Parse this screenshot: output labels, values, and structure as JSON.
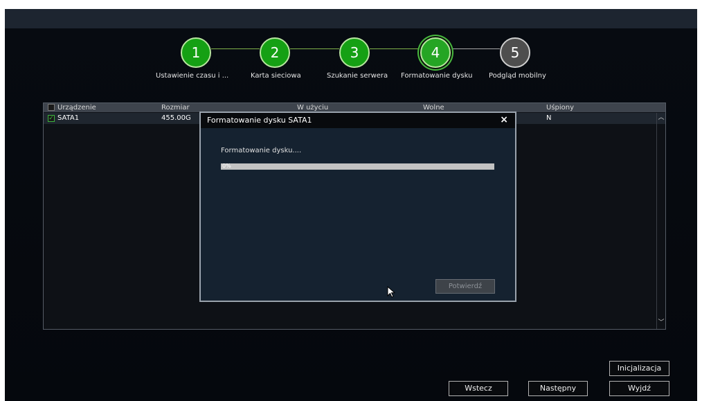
{
  "wizard": {
    "steps": [
      {
        "number": "1",
        "label": "Ustawienie czasu i ..."
      },
      {
        "number": "2",
        "label": "Karta sieciowa"
      },
      {
        "number": "3",
        "label": "Szukanie serwera"
      },
      {
        "number": "4",
        "label": "Formatowanie dysku"
      },
      {
        "number": "5",
        "label": "Podgląd mobilny"
      }
    ],
    "active_step": "4",
    "colors": {
      "done": "#15a014",
      "pending": "#4e4e4e"
    }
  },
  "disk_table": {
    "headers": [
      "Urządzenie",
      "Rozmiar",
      "W użyciu",
      "Wolne",
      "Uśpiony"
    ],
    "rows": [
      {
        "checked": true,
        "device": "SATA1",
        "size": "455.00G",
        "sleep": "N"
      }
    ]
  },
  "dialog": {
    "title": "Formatowanie dysku SATA1",
    "close_symbol": "×",
    "status": "Formatowanie dysku....",
    "progress_percent": 0,
    "progress_text": "0%",
    "confirm_label": "Potwierdź"
  },
  "buttons": {
    "init": "Inicjalizacja",
    "back": "Wstecz",
    "next": "Następny",
    "exit": "Wyjdź"
  }
}
